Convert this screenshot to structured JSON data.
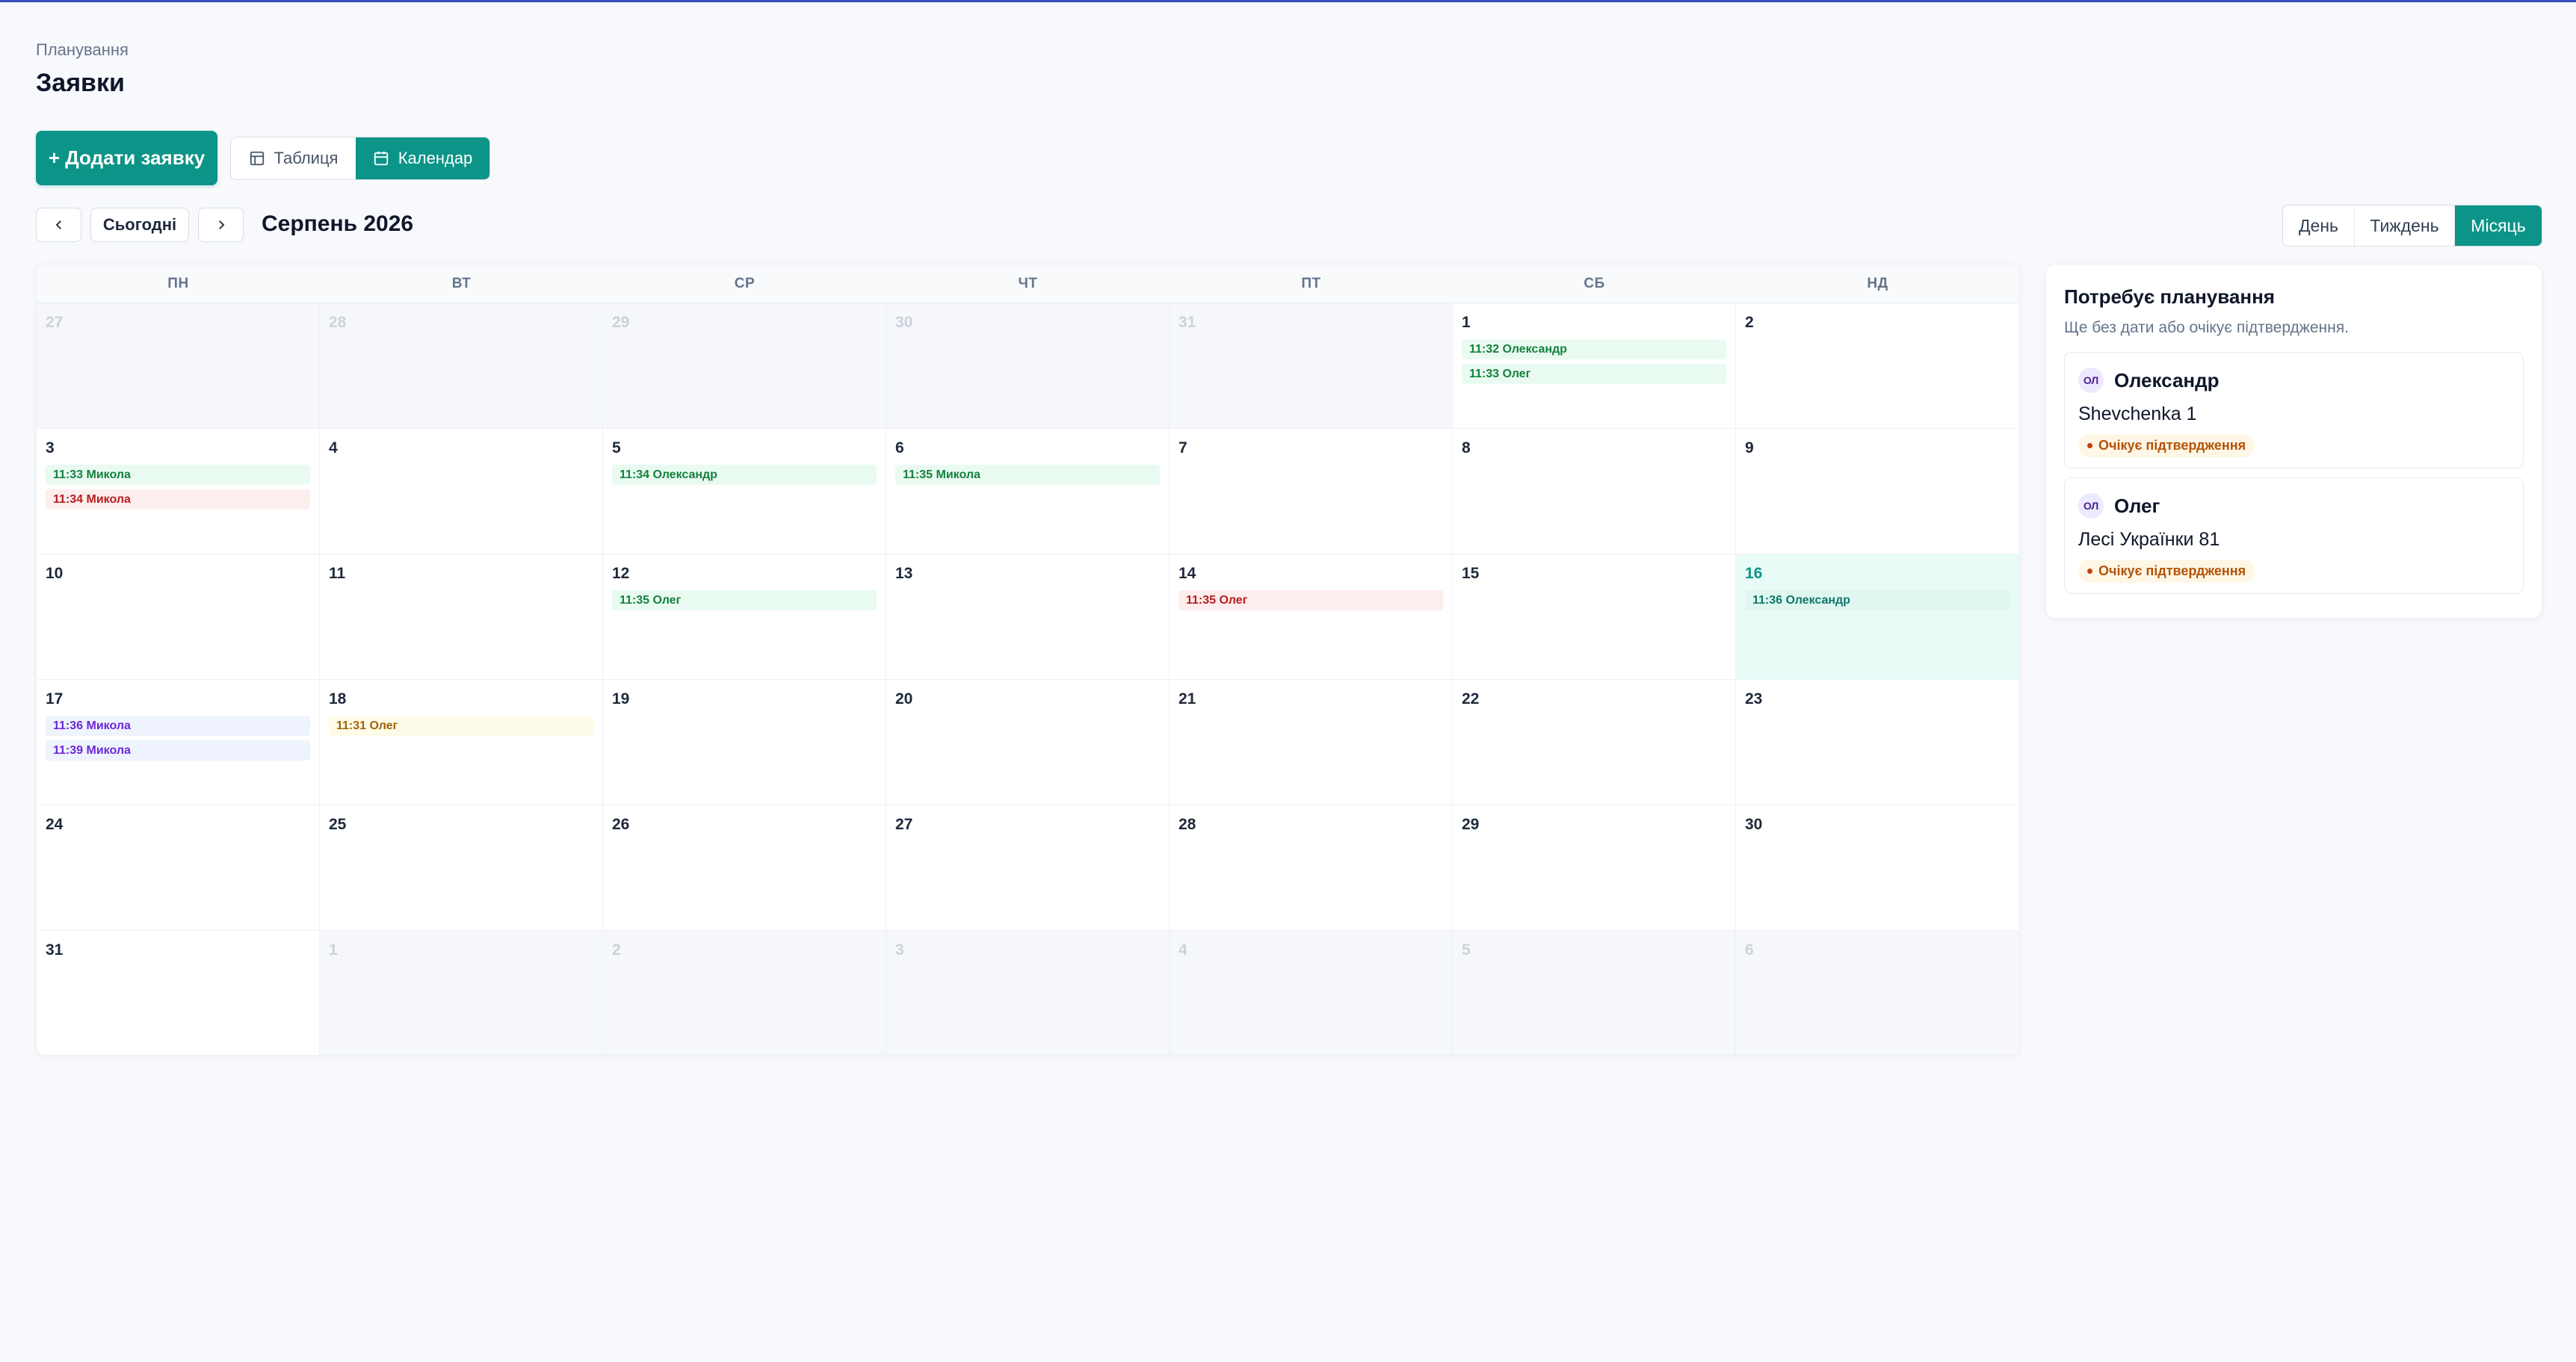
{
  "breadcrumb": "Планування",
  "page_title": "Заявки",
  "toolbar": {
    "add_label": "+ Додати заявку",
    "view_table": "Таблиця",
    "view_calendar": "Календар",
    "active_view": "Календар"
  },
  "nav": {
    "today": "Сьогодні",
    "month_label": "Серпень 2026"
  },
  "range": {
    "day": "День",
    "week": "Тиждень",
    "month": "Місяць",
    "active": "Місяць"
  },
  "colors": {
    "accent": "#0d9488",
    "event_green": "#15803d",
    "event_red": "#b91c1c",
    "event_purple": "#6d28d9",
    "event_yellow": "#a16207",
    "event_teal": "#0f766e"
  },
  "calendar": {
    "weekdays": [
      "ПН",
      "ВТ",
      "СР",
      "ЧТ",
      "ПТ",
      "СБ",
      "НД"
    ],
    "today": "16",
    "days": [
      {
        "n": "27",
        "outside": true,
        "events": []
      },
      {
        "n": "28",
        "outside": true,
        "events": []
      },
      {
        "n": "29",
        "outside": true,
        "events": []
      },
      {
        "n": "30",
        "outside": true,
        "events": []
      },
      {
        "n": "31",
        "outside": true,
        "events": []
      },
      {
        "n": "1",
        "events": [
          {
            "text": "11:32 Олександр",
            "color": "green"
          },
          {
            "text": "11:33 Олег",
            "color": "green"
          }
        ]
      },
      {
        "n": "2",
        "events": []
      },
      {
        "n": "3",
        "events": [
          {
            "text": "11:33 Микола",
            "color": "green"
          },
          {
            "text": "11:34 Микола",
            "color": "red"
          }
        ]
      },
      {
        "n": "4",
        "events": []
      },
      {
        "n": "5",
        "events": [
          {
            "text": "11:34 Олександр",
            "color": "green"
          }
        ]
      },
      {
        "n": "6",
        "events": [
          {
            "text": "11:35 Микола",
            "color": "green"
          }
        ]
      },
      {
        "n": "7",
        "events": []
      },
      {
        "n": "8",
        "events": []
      },
      {
        "n": "9",
        "events": []
      },
      {
        "n": "10",
        "events": []
      },
      {
        "n": "11",
        "events": []
      },
      {
        "n": "12",
        "events": [
          {
            "text": "11:35 Олег",
            "color": "green"
          }
        ]
      },
      {
        "n": "13",
        "events": []
      },
      {
        "n": "14",
        "events": [
          {
            "text": "11:35 Олег",
            "color": "red"
          }
        ]
      },
      {
        "n": "15",
        "events": []
      },
      {
        "n": "16",
        "today": true,
        "events": [
          {
            "text": "11:36 Олександр",
            "color": "teal"
          }
        ]
      },
      {
        "n": "17",
        "events": [
          {
            "text": "11:36 Микола",
            "color": "purple"
          },
          {
            "text": "11:39 Микола",
            "color": "purple"
          }
        ]
      },
      {
        "n": "18",
        "events": [
          {
            "text": "11:31 Олег",
            "color": "yellow"
          }
        ]
      },
      {
        "n": "19",
        "events": []
      },
      {
        "n": "20",
        "events": []
      },
      {
        "n": "21",
        "events": []
      },
      {
        "n": "22",
        "events": []
      },
      {
        "n": "23",
        "events": []
      },
      {
        "n": "24",
        "events": []
      },
      {
        "n": "25",
        "events": []
      },
      {
        "n": "26",
        "events": []
      },
      {
        "n": "27",
        "events": []
      },
      {
        "n": "28",
        "events": []
      },
      {
        "n": "29",
        "events": []
      },
      {
        "n": "30",
        "events": []
      },
      {
        "n": "31",
        "events": []
      },
      {
        "n": "1",
        "outside": true,
        "events": []
      },
      {
        "n": "2",
        "outside": true,
        "events": []
      },
      {
        "n": "3",
        "outside": true,
        "events": []
      },
      {
        "n": "4",
        "outside": true,
        "events": []
      },
      {
        "n": "5",
        "outside": true,
        "events": []
      },
      {
        "n": "6",
        "outside": true,
        "events": []
      }
    ]
  },
  "panel": {
    "title": "Потребує планування",
    "subtitle": "Ще без дати або очікує підтвердження.",
    "cards": [
      {
        "initials": "ОЛ",
        "name": "Олександр",
        "address": "Shevchenka 1",
        "status": "Очікує підтвердження"
      },
      {
        "initials": "ОЛ",
        "name": "Олег",
        "address": "Лесі Українки 81",
        "status": "Очікує підтвердження"
      }
    ]
  },
  "icons": {
    "table_view": "table-icon",
    "calendar_view": "calendar-icon",
    "prev": "chevron-left-icon",
    "next": "chevron-right-icon"
  }
}
